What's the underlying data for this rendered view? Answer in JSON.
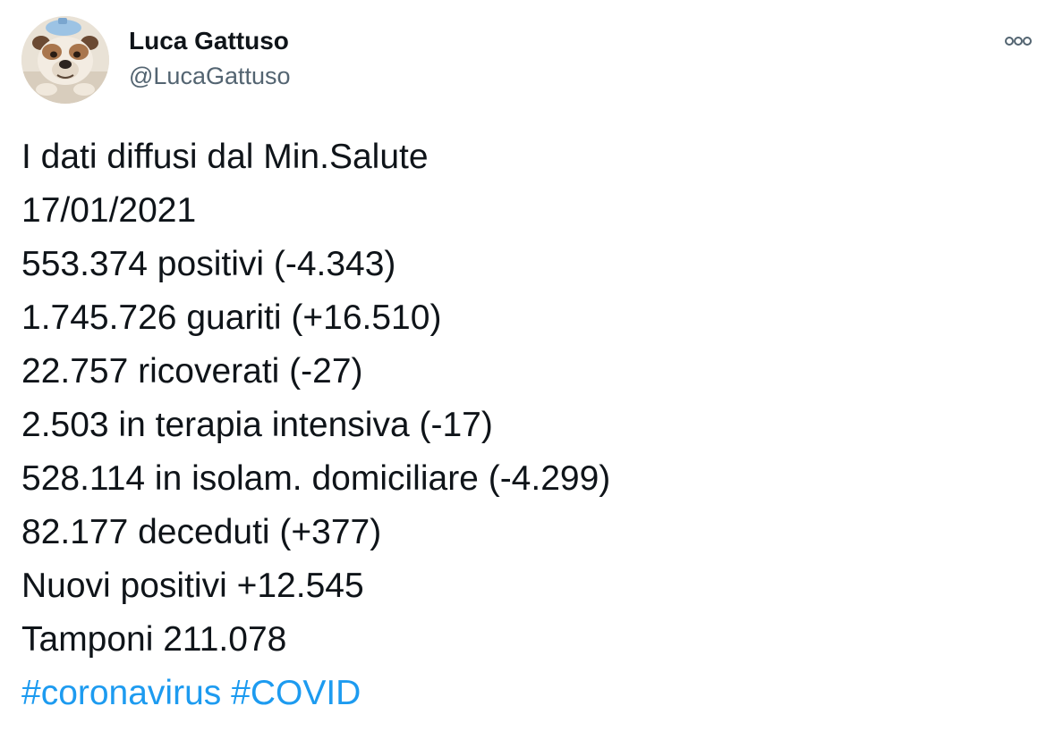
{
  "tweet": {
    "author": {
      "name": "Luca Gattuso",
      "handle": "@LucaGattuso"
    },
    "lines": [
      "I dati diffusi dal Min.Salute",
      "17/01/2021",
      "553.374 positivi (-4.343)",
      "1.745.726 guariti (+16.510)",
      "22.757 ricoverati (-27)",
      "2.503 in terapia intensiva (-17)",
      "528.114 in isolam. domiciliare (-4.299)",
      "82.177 deceduti (+377)",
      "Nuovi positivi +12.545",
      "Tamponi 211.078"
    ],
    "hashtags": [
      "#coronavirus",
      "#COVID"
    ]
  },
  "icons": {
    "avatar": "bulldog-avatar",
    "more": "more-options-icon"
  },
  "colors": {
    "text": "#0f1419",
    "secondary": "#536471",
    "link": "#1d9bf0"
  }
}
